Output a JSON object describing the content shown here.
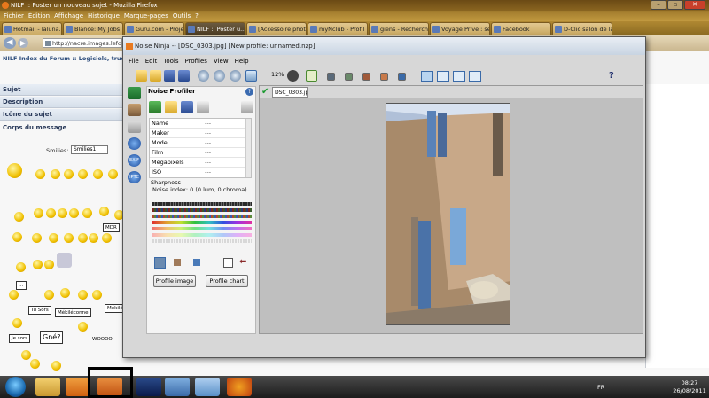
{
  "firefox": {
    "title": "NILF :: Poster un nouveau sujet - Mozilla Firefox",
    "menu": [
      "Fichier",
      "Édition",
      "Affichage",
      "Historique",
      "Marque-pages",
      "Outils",
      "?"
    ],
    "tabs": [
      {
        "label": "Hotmail - laluna..."
      },
      {
        "label": "Blance: My Jobs"
      },
      {
        "label": "Guru.com - Proje..."
      },
      {
        "label": "NILF :: Poster u..."
      },
      {
        "label": "[Accessoire photo..."
      },
      {
        "label": "myNclub - Profil"
      },
      {
        "label": "giens - Recherche..."
      },
      {
        "label": "Voyage Privé : se..."
      },
      {
        "label": "Facebook"
      },
      {
        "label": "D-Clic salon de la..."
      }
    ],
    "url": "http://nacre.images.lefor..."
  },
  "forum": {
    "header": "NILF Index du Forum :: Logiciels, trucs e",
    "rows": [
      "Sujet",
      "Description",
      "Icône du sujet"
    ],
    "body_label": "Corps du message",
    "smilies_label": "Smilies:",
    "smilies_value": "Smilies1",
    "signs": [
      "MDR",
      "Tu Sors",
      "Mékiléconne",
      "Mékiléco",
      "Je sors",
      "Gné?",
      "WOOOO"
    ]
  },
  "noise_ninja": {
    "title": "Noise Ninja -- [DSC_0303.jpg] [New profile: unnamed.nzp]",
    "menu": [
      "File",
      "Edit",
      "Tools",
      "Profiles",
      "View",
      "Help"
    ],
    "zoom": "12%",
    "profiler": {
      "title": "Noise Profiler",
      "metadata": [
        {
          "key": "Name",
          "value": "---"
        },
        {
          "key": "Maker",
          "value": "---"
        },
        {
          "key": "Model",
          "value": "---"
        },
        {
          "key": "Film",
          "value": "---"
        },
        {
          "key": "Megapixels",
          "value": "---"
        },
        {
          "key": "ISO",
          "value": "---"
        },
        {
          "key": "Sharpness",
          "value": "---"
        }
      ],
      "noise_index": "Noise index:  0 (0 lum, 0 chroma)",
      "buttons": {
        "profile_image": "Profile image",
        "profile_chart": "Profile chart"
      }
    },
    "image_tab": "DSC_0303.jpg"
  },
  "tray": {
    "language": "FR",
    "time": "08:27",
    "date": "26/08/2011"
  }
}
